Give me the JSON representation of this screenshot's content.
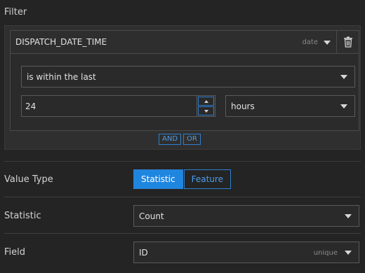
{
  "filter": {
    "title": "Filter",
    "field_name": "DISPATCH_DATE_TIME",
    "field_type": "date",
    "operator": "is within the last",
    "value": "24",
    "unit": "hours",
    "and_label": "AND",
    "or_label": "OR"
  },
  "value_type": {
    "label": "Value Type",
    "options": [
      "Statistic",
      "Feature"
    ],
    "selected": "Statistic"
  },
  "statistic": {
    "label": "Statistic",
    "value": "Count"
  },
  "field": {
    "label": "Field",
    "value": "ID",
    "tag": "unique"
  },
  "colors": {
    "accent": "#1f86e0",
    "background": "#242424",
    "panel": "#2f2f2f"
  }
}
